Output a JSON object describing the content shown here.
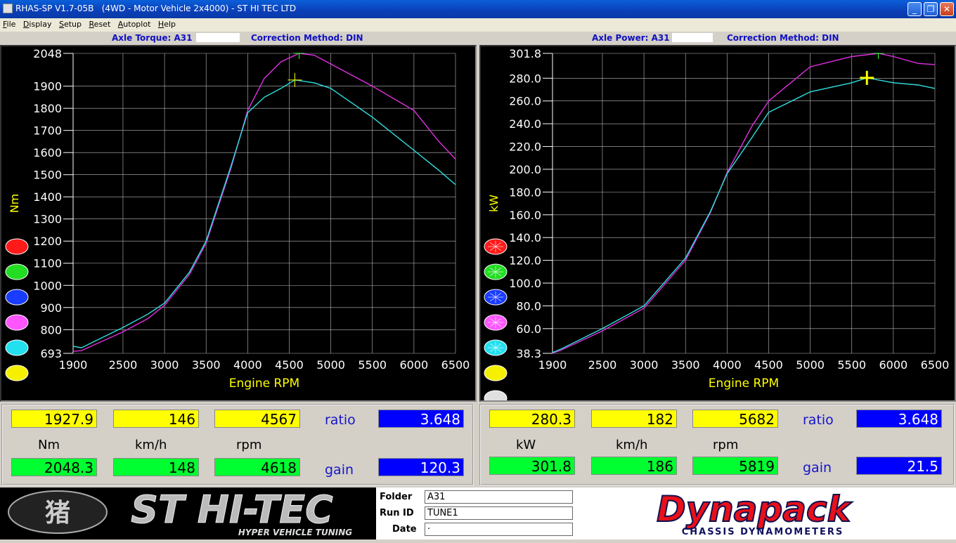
{
  "window": {
    "title": "RHAS-SP V1.7-05B   (4WD - Motor Vehicle 2x4000) - ST HI TEC LTD",
    "buttons": {
      "minimize": "_",
      "restore": "❐",
      "close": "✕"
    }
  },
  "menu": [
    "File",
    "Display",
    "Setup",
    "Reset",
    "Autoplot",
    "Help"
  ],
  "left": {
    "header_label": "Axle Torque: A31",
    "correction": "Correction Method: DIN",
    "y_axis_label": "Nm",
    "x_axis_label": "Engine RPM",
    "y_ticks": [
      "2048",
      "1900",
      "1800",
      "1700",
      "1600",
      "1500",
      "1400",
      "1300",
      "1200",
      "1100",
      "1000",
      "900",
      "800",
      "693"
    ],
    "x_ticks": [
      "1900",
      "2500",
      "3000",
      "3500",
      "4000",
      "4500",
      "5000",
      "5500",
      "6000",
      "6500"
    ],
    "readout": {
      "current": {
        "value": "1927.9",
        "speed": "146",
        "rpm": "4567"
      },
      "peak": {
        "value": "2048.3",
        "speed": "148",
        "rpm": "4618"
      },
      "units": {
        "value": "Nm",
        "speed": "km/h",
        "rpm": "rpm"
      },
      "ratio_label": "ratio",
      "ratio": "3.648",
      "gain_label": "gain",
      "gain": "120.3"
    }
  },
  "right": {
    "header_label": "Axle Power: A31",
    "correction": "Correction Method: DIN",
    "y_axis_label": "kW",
    "x_axis_label": "Engine RPM",
    "y_ticks": [
      "301.8",
      "280.0",
      "260.0",
      "240.0",
      "220.0",
      "200.0",
      "180.0",
      "160.0",
      "140.0",
      "120.0",
      "100.0",
      "80.0",
      "60.0",
      "38.3"
    ],
    "x_ticks": [
      "1900",
      "2500",
      "3000",
      "3500",
      "4000",
      "4500",
      "5000",
      "5500",
      "6000",
      "6500"
    ],
    "readout": {
      "current": {
        "value": "280.3",
        "speed": "182",
        "rpm": "5682"
      },
      "peak": {
        "value": "301.8",
        "speed": "186",
        "rpm": "5819"
      },
      "units": {
        "value": "kW",
        "speed": "km/h",
        "rpm": "rpm"
      },
      "ratio_label": "ratio",
      "ratio": "3.648",
      "gain_label": "gain",
      "gain": "21.5"
    }
  },
  "color_buttons": [
    "#ff1a1a",
    "#22dd22",
    "#1a3cff",
    "#ff55ff",
    "#22e0f0",
    "#f5f000",
    "#e0e0e0"
  ],
  "series_colors": {
    "magenta": "#e030e0",
    "cyan": "#30e0e0"
  },
  "footer": {
    "logo_text": "ST HI-TEC",
    "logo_tagline": "HYPER VEHICLE TUNING",
    "folder_label": "Folder",
    "folder": "A31",
    "runid_label": "Run ID",
    "runid": "TUNE1",
    "date_label": "Date",
    "date": "·",
    "brand": "Dynapack",
    "brand_tagline": "CHASSIS   DYNAMOMETERS"
  },
  "chart_data": [
    {
      "type": "line",
      "title": "Axle Torque: A31",
      "xlabel": "Engine RPM",
      "ylabel": "Nm",
      "xlim": [
        1900,
        6500
      ],
      "ylim": [
        693,
        2048
      ],
      "series": [
        {
          "x": [
            1900,
            2000,
            2500,
            2800,
            3000,
            3300,
            3500,
            3800,
            4000,
            4200,
            4400,
            4618,
            4800,
            5000,
            5500,
            6000,
            6300,
            6500
          ],
          "y": [
            702,
            705,
            790,
            850,
            910,
            1050,
            1190,
            1530,
            1790,
            1935,
            2010,
            2048,
            2040,
            2000,
            1900,
            1790,
            1650,
            1570
          ]
        },
        {
          "x": [
            1900,
            2000,
            2500,
            2800,
            3000,
            3300,
            3500,
            3800,
            4000,
            4200,
            4400,
            4567,
            4800,
            5000,
            5500,
            6000,
            6300,
            6500
          ],
          "y": [
            725,
            718,
            810,
            870,
            920,
            1060,
            1200,
            1540,
            1780,
            1850,
            1890,
            1928,
            1915,
            1890,
            1760,
            1610,
            1520,
            1455
          ]
        }
      ]
    },
    {
      "type": "line",
      "title": "Axle Power: A31",
      "xlabel": "Engine RPM",
      "ylabel": "kW",
      "xlim": [
        1900,
        6500
      ],
      "ylim": [
        38.3,
        301.8
      ],
      "series": [
        {
          "x": [
            1900,
            2000,
            2500,
            3000,
            3500,
            3800,
            4000,
            4300,
            4500,
            5000,
            5500,
            5819,
            6000,
            6300,
            6500
          ],
          "y": [
            38.5,
            41,
            58,
            78,
            120,
            162,
            197,
            238,
            260,
            290,
            299,
            301.8,
            299,
            293,
            292
          ]
        },
        {
          "x": [
            1900,
            2000,
            2500,
            3000,
            3500,
            3800,
            4000,
            4300,
            4500,
            5000,
            5500,
            5682,
            6000,
            6300,
            6500
          ],
          "y": [
            39,
            42,
            60,
            80,
            122,
            163,
            196,
            228,
            250,
            268,
            276,
            280.3,
            276,
            274,
            271
          ]
        }
      ]
    }
  ]
}
